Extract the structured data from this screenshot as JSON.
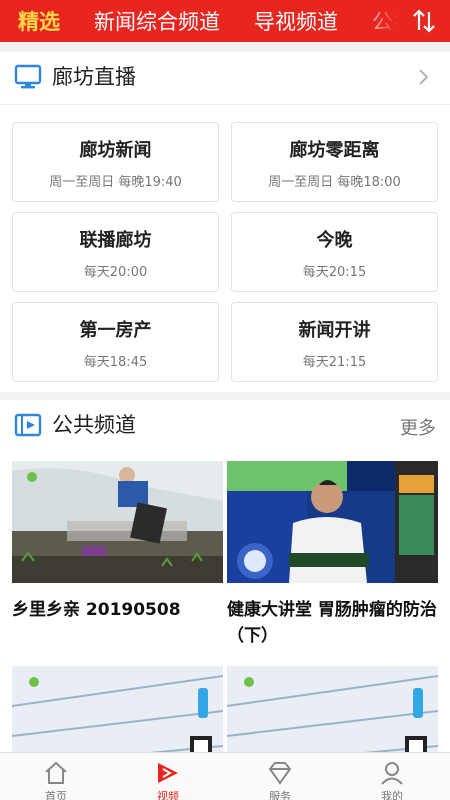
{
  "top_tabs": [
    "精选",
    "新闻综合频道",
    "导视频道",
    "公共"
  ],
  "live_section": {
    "title": "廊坊直播",
    "programs": [
      {
        "name": "廊坊新闻",
        "time": "周一至周日 每晚19:40"
      },
      {
        "name": "廊坊零距离",
        "time": "周一至周日 每晚18:00"
      },
      {
        "name": "联播廊坊",
        "time": "每天20:00"
      },
      {
        "name": "今晚",
        "time": "每天20:15"
      },
      {
        "name": "第一房产",
        "time": "每天18:45"
      },
      {
        "name": "新闻开讲",
        "time": "每天21:15"
      }
    ]
  },
  "public_section": {
    "title": "公共频道",
    "more": "更多",
    "videos": [
      {
        "title": "乡里乡亲 20190508"
      },
      {
        "title": "健康大讲堂 胃肠肿瘤的防治（下）"
      },
      {
        "title": ""
      },
      {
        "title": ""
      }
    ]
  },
  "bottom_nav": [
    {
      "label": "首页",
      "icon": "home-icon"
    },
    {
      "label": "视频",
      "icon": "video-icon"
    },
    {
      "label": "服务",
      "icon": "service-icon"
    },
    {
      "label": "我的",
      "icon": "user-icon"
    }
  ],
  "colors": {
    "brand_red": "#e8261f",
    "active_tab": "#ffd84a",
    "accent_blue": "#2e86de"
  }
}
